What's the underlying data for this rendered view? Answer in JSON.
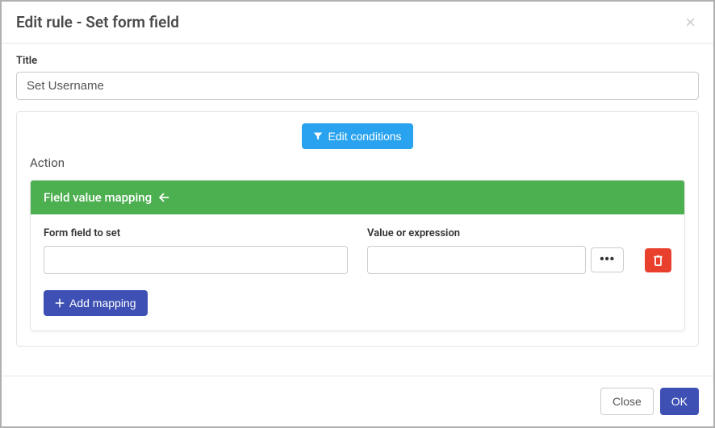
{
  "modal": {
    "title": "Edit rule - Set form field"
  },
  "form": {
    "titleLabel": "Title",
    "titleValue": "Set Username"
  },
  "buttons": {
    "editConditions": "Edit conditions",
    "addMapping": "Add mapping",
    "close": "Close",
    "ok": "OK"
  },
  "action": {
    "sectionLabel": "Action",
    "mappingHeader": "Field value mapping",
    "formFieldLabel": "Form field to set",
    "valueLabel": "Value or expression",
    "formFieldValue": "",
    "valueExpressionValue": ""
  }
}
